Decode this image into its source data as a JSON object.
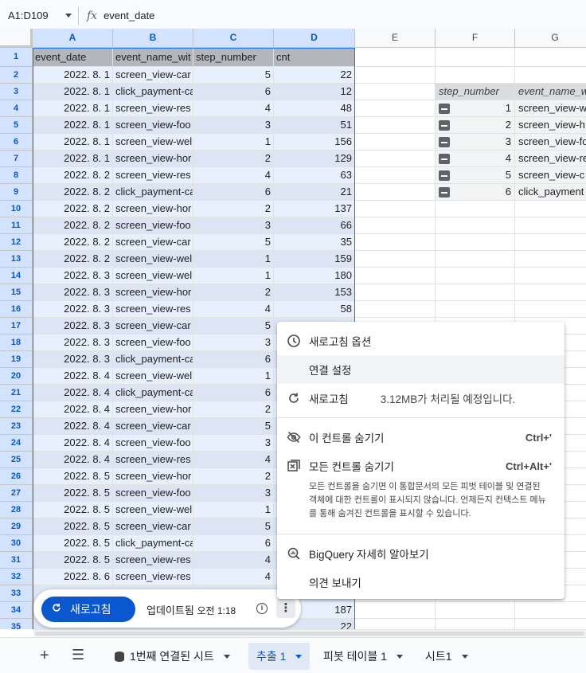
{
  "formula_bar": {
    "name_box": "A1:D109",
    "fx": "fx",
    "value": "event_date"
  },
  "columns": [
    "A",
    "B",
    "C",
    "D",
    "E",
    "F",
    "G"
  ],
  "rows": [
    "1",
    "2",
    "3",
    "4",
    "5",
    "6",
    "7",
    "8",
    "9",
    "10",
    "11",
    "12",
    "13",
    "14",
    "15",
    "16",
    "17",
    "18",
    "19",
    "20",
    "21",
    "22",
    "23",
    "24",
    "25",
    "26",
    "27",
    "28",
    "29",
    "30",
    "31",
    "32",
    "33",
    "34",
    "35"
  ],
  "headers": [
    "event_date",
    "event_name_wit",
    "step_number",
    "cnt"
  ],
  "data": [
    [
      "2022. 8. 1",
      "screen_view-car",
      "5",
      "22"
    ],
    [
      "2022. 8. 1",
      "click_payment-ca",
      "6",
      "12"
    ],
    [
      "2022. 8. 1",
      "screen_view-res",
      "4",
      "48"
    ],
    [
      "2022. 8. 1",
      "screen_view-foo",
      "3",
      "51"
    ],
    [
      "2022. 8. 1",
      "screen_view-wel",
      "1",
      "156"
    ],
    [
      "2022. 8. 1",
      "screen_view-hor",
      "2",
      "129"
    ],
    [
      "2022. 8. 2",
      "screen_view-res",
      "4",
      "63"
    ],
    [
      "2022. 8. 2",
      "click_payment-ca",
      "6",
      "21"
    ],
    [
      "2022. 8. 2",
      "screen_view-hor",
      "2",
      "137"
    ],
    [
      "2022. 8. 2",
      "screen_view-foo",
      "3",
      "66"
    ],
    [
      "2022. 8. 2",
      "screen_view-car",
      "5",
      "35"
    ],
    [
      "2022. 8. 2",
      "screen_view-wel",
      "1",
      "159"
    ],
    [
      "2022. 8. 3",
      "screen_view-wel",
      "1",
      "180"
    ],
    [
      "2022. 8. 3",
      "screen_view-hor",
      "2",
      "153"
    ],
    [
      "2022. 8. 3",
      "screen_view-res",
      "4",
      "58"
    ],
    [
      "2022. 8. 3",
      "screen_view-car",
      "5",
      ""
    ],
    [
      "2022. 8. 3",
      "screen_view-foo",
      "3",
      ""
    ],
    [
      "2022. 8. 3",
      "click_payment-ca",
      "6",
      ""
    ],
    [
      "2022. 8. 4",
      "screen_view-wel",
      "1",
      ""
    ],
    [
      "2022. 8. 4",
      "click_payment-ca",
      "6",
      ""
    ],
    [
      "2022. 8. 4",
      "screen_view-hor",
      "2",
      ""
    ],
    [
      "2022. 8. 4",
      "screen_view-car",
      "5",
      ""
    ],
    [
      "2022. 8. 4",
      "screen_view-foo",
      "3",
      ""
    ],
    [
      "2022. 8. 4",
      "screen_view-res",
      "4",
      ""
    ],
    [
      "2022. 8. 5",
      "screen_view-hor",
      "2",
      ""
    ],
    [
      "2022. 8. 5",
      "screen_view-foo",
      "3",
      ""
    ],
    [
      "2022. 8. 5",
      "screen_view-wel",
      "1",
      ""
    ],
    [
      "2022. 8. 5",
      "screen_view-car",
      "5",
      ""
    ],
    [
      "2022. 8. 5",
      "click_payment-ca",
      "6",
      ""
    ],
    [
      "2022. 8. 5",
      "screen_view-res",
      "4",
      ""
    ],
    [
      "2022. 8. 6",
      "screen_view-res",
      "4",
      ""
    ],
    [
      "",
      "",
      "",
      ""
    ],
    [
      "",
      "",
      "",
      "187"
    ],
    [
      "",
      "",
      "",
      "22"
    ]
  ],
  "pivot": {
    "headers": [
      "step_number",
      "event_name_w"
    ],
    "rows": [
      [
        "1",
        "screen_view-w"
      ],
      [
        "2",
        "screen_view-h"
      ],
      [
        "3",
        "screen_view-fo"
      ],
      [
        "4",
        "screen_view-re"
      ],
      [
        "5",
        "screen_view-c"
      ],
      [
        "6",
        "click_payment"
      ]
    ]
  },
  "menu": {
    "refresh_options": "새로고침 옵션",
    "connection_settings": "연결 설정",
    "refresh": "새로고침",
    "refresh_note": "3.12MB가 처리될 예정입니다.",
    "hide_this": "이 컨트롤 숨기기",
    "hide_this_shortcut": "Ctrl+'",
    "hide_all": "모든 컨트롤 숨기기",
    "hide_all_shortcut": "Ctrl+Alt+'",
    "hide_all_desc": "모든 컨트롤을 숨기면 이 통합문서의 모든 피벗 테이블 및 연결된 객체에 대한 컨트롤이 표시되지 않습니다. 언제든지 컨텍스트 메뉴를 통해 숨겨진 컨트롤을 표시할 수 있습니다.",
    "learn_more": "BigQuery 자세히 알아보기",
    "feedback": "의견 보내기"
  },
  "refresh_bar": {
    "button": "새로고침",
    "updated": "업데이트됨",
    "time": "오전 1:18"
  },
  "tabs": [
    {
      "label": "1번째 연결된 시트"
    },
    {
      "label": "추출 1"
    },
    {
      "label": "피봇 테이블 1"
    },
    {
      "label": "시트1"
    }
  ]
}
